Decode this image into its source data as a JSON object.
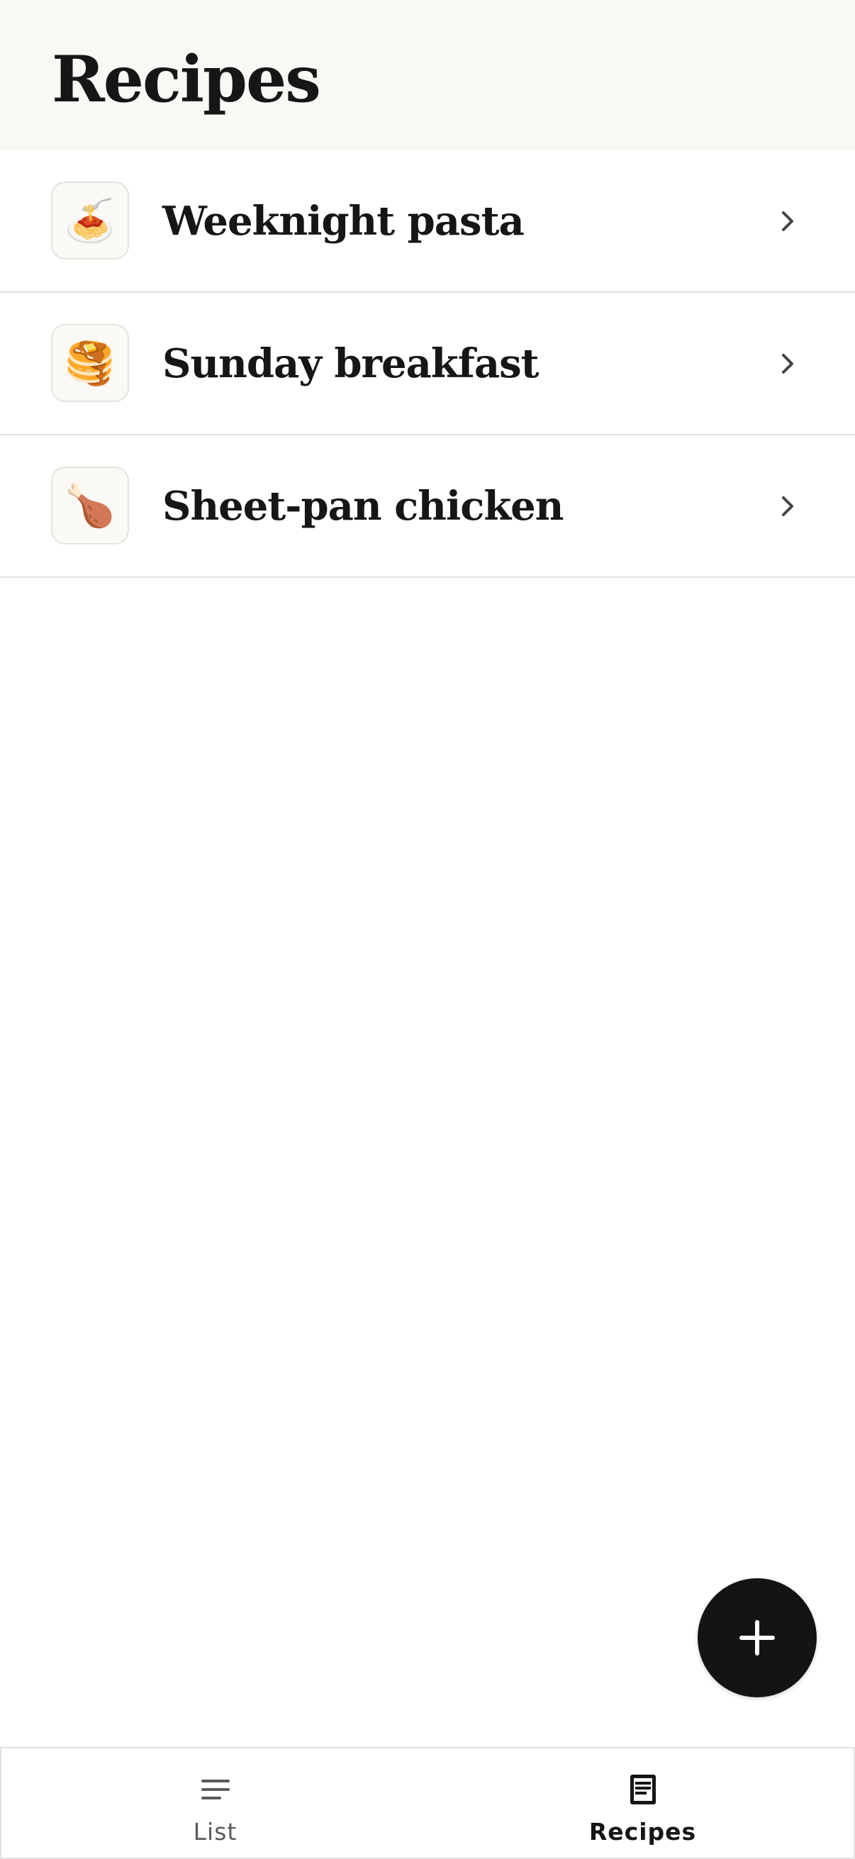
{
  "header": {
    "title": "Recipes"
  },
  "recipes": [
    {
      "icon": "🍝",
      "icon_name": "spaghetti-icon",
      "name": "Weeknight pasta"
    },
    {
      "icon": "🥞",
      "icon_name": "pancakes-icon",
      "name": "Sunday breakfast"
    },
    {
      "icon": "🍗",
      "icon_name": "poultry-leg-icon",
      "name": "Sheet-pan chicken"
    }
  ],
  "fab": {
    "icon": "plus-icon"
  },
  "bottom_nav": {
    "items": [
      {
        "label": "List",
        "icon": "hamburger-list-icon",
        "active": false
      },
      {
        "label": "Recipes",
        "icon": "document-icon",
        "active": true
      }
    ]
  },
  "colors": {
    "header_bg": "#faf8f4",
    "text": "#161616",
    "divider": "#e2e2e0",
    "fab_bg": "#141414",
    "inactive_nav": "#5a5a5a"
  }
}
